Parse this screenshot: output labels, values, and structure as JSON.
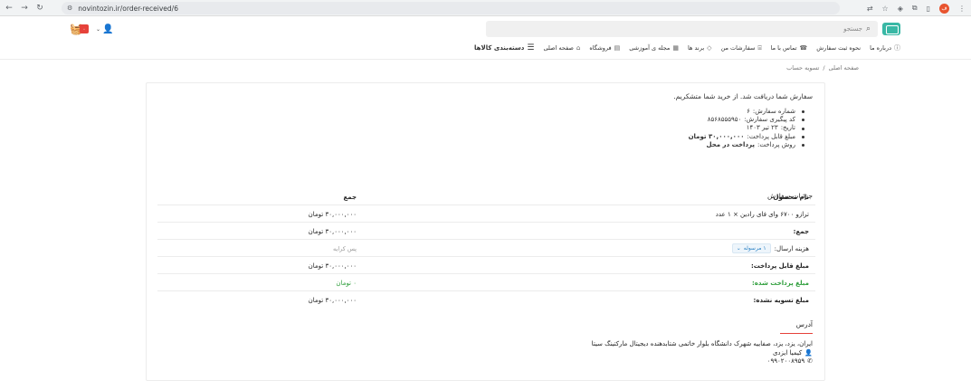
{
  "browser": {
    "url": "novintozin.ir/order-received/6",
    "profile_initial": "ف"
  },
  "header": {
    "search_placeholder": "جستجو",
    "cart_count": "۰"
  },
  "menu": [
    {
      "label": "دسته‌بندی کالاها",
      "icon": "menu-icon"
    },
    {
      "label": "صفحه اصلی",
      "icon": "home-icon"
    },
    {
      "label": "فروشگاه",
      "icon": "store-icon"
    },
    {
      "label": "مجله ی آموزشی",
      "icon": "magazine-icon"
    },
    {
      "label": "برند ها",
      "icon": "tag-icon"
    },
    {
      "label": "سفارشات من",
      "icon": "orders-icon"
    },
    {
      "label": "تماس با ما",
      "icon": "phone-icon"
    },
    {
      "label": "نحوه ثبت سفارش",
      "icon": ""
    },
    {
      "label": "درباره ما",
      "icon": "info-icon"
    }
  ],
  "breadcrumb": {
    "home": "صفحه اصلی",
    "separator": "/",
    "current": "تسویه حساب"
  },
  "order": {
    "thanks": "سفارش شما دریافت شد. از خرید شما متشکریم.",
    "summary": [
      {
        "label": "شماره سفارش:",
        "value": "۶"
      },
      {
        "label": "کد پیگیری سفارش:",
        "value": "۸۵۶۸۵۵۵۹۵۰"
      },
      {
        "label": "تاریخ:",
        "value": "۲۳ تیر ۱۴۰۳"
      },
      {
        "label": "مبلغ قابل پرداخت:",
        "value": "۳۰,۰۰۰,۰۰۰ تومان"
      },
      {
        "label": "روش پرداخت:",
        "value": "پرداخت در محل"
      }
    ],
    "details_title": "جزئیات سفارش",
    "table": {
      "col_product": "نام محصول",
      "col_total": "جمع",
      "rows": [
        {
          "label": "ترازو ۶۷۰۰ وای فای رادین × ۱ عدد",
          "value": "۳۰,۰۰۰,۰۰۰ تومان"
        },
        {
          "label": "جمع:",
          "value": "۳۰,۰۰۰,۰۰۰ تومان"
        },
        {
          "label": "هزینه ارسال:",
          "select": "۱ مرسوله",
          "value": "پس کرایه"
        },
        {
          "label": "مبلغ قابل پرداخت:",
          "value": "۳۰,۰۰۰,۰۰۰ تومان"
        },
        {
          "label": "مبلغ پرداخت شده:",
          "value": "۰ تومان"
        },
        {
          "label": "مبلغ تسویه نشده:",
          "value": "۳۰,۰۰۰,۰۰۰ تومان"
        }
      ]
    },
    "address_title": "آدرس",
    "address": {
      "line": "ایران، یزد، یزد، صفاییه شهرک دانشگاه بلوار خاتمی شتابدهنده دیجیتال مارکتینگ سیتا",
      "name": "کیمیا ایزدی",
      "phone": "۰۹۹۰۲۰۰۸۹۵۹"
    }
  },
  "colors": {
    "accent": "#e6423a",
    "green": "#2e9e3b",
    "logo": "#39b8a5"
  }
}
